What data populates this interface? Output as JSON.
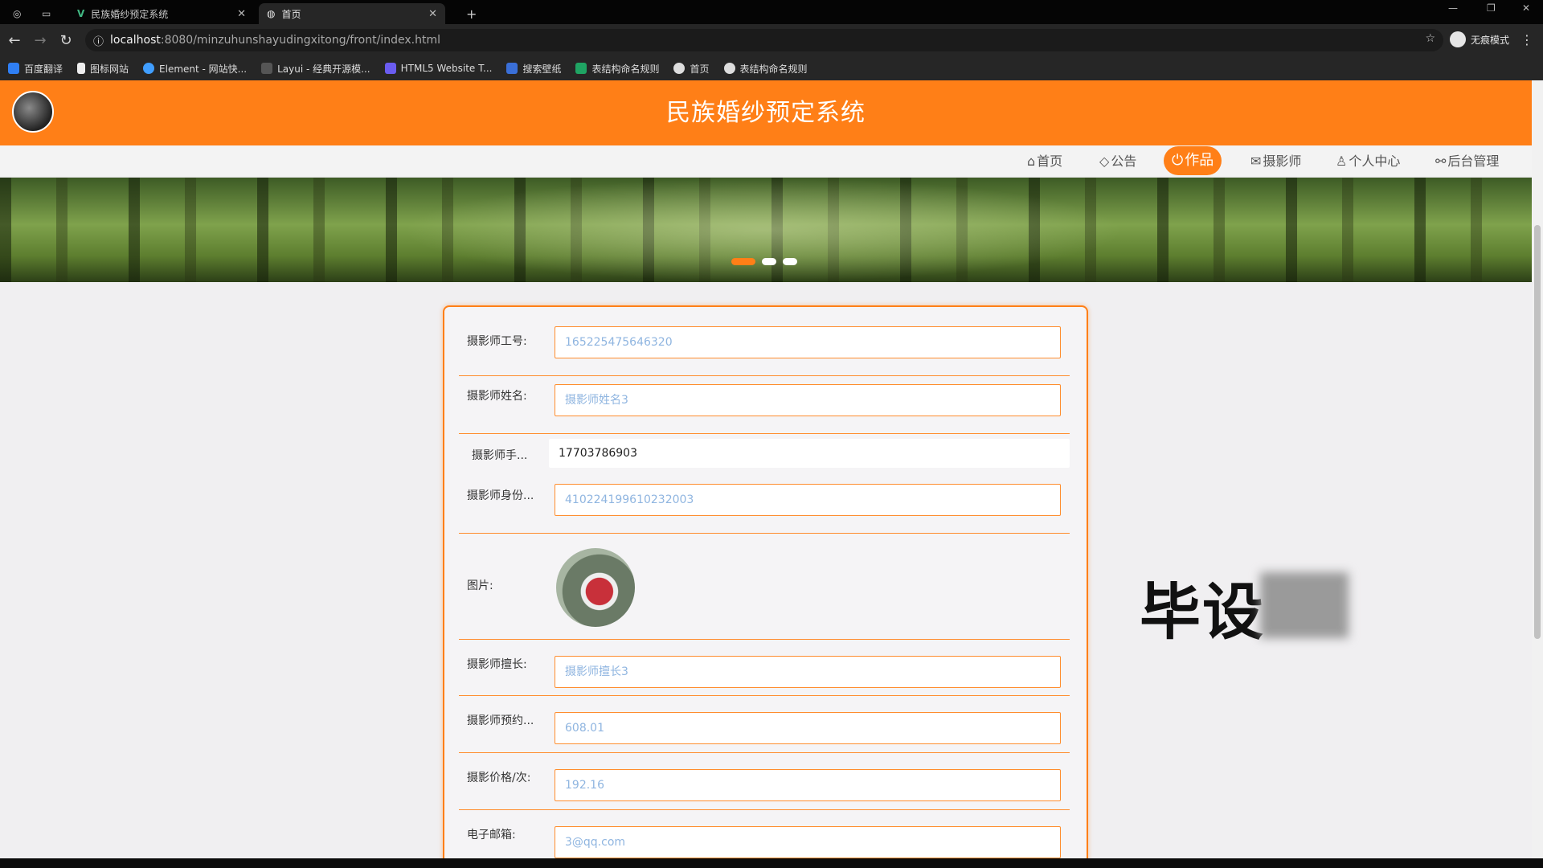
{
  "browser": {
    "tabs": [
      {
        "title": "民族婚纱预定系统",
        "active": false
      },
      {
        "title": "首页",
        "active": true
      }
    ],
    "new_tab": "+",
    "url_host": "localhost",
    "url_rest": ":8080/minzuhunshayudingxitong/front/index.html",
    "incognito_label": "无痕模式",
    "bookmarks": [
      "百度翻译",
      "图标网站",
      "Element - 网站快...",
      "Layui - 经典开源模...",
      "HTML5 Website T...",
      "搜索壁纸",
      "表结构命名规则",
      "首页",
      "表结构命名规则"
    ]
  },
  "site": {
    "title": "民族婚纱预定系统",
    "nav": [
      {
        "label": "首页",
        "icon": "home-icon",
        "active": false
      },
      {
        "label": "公告",
        "icon": "tag-icon",
        "active": false
      },
      {
        "label": "作品",
        "icon": "power-icon",
        "active": true
      },
      {
        "label": "摄影师",
        "icon": "mail-icon",
        "active": false
      },
      {
        "label": "个人中心",
        "icon": "user-icon",
        "active": false
      },
      {
        "label": "后台管理",
        "icon": "link-icon",
        "active": false
      }
    ],
    "carousel_active_index": 0
  },
  "form": {
    "fields": [
      {
        "label": "摄影师工号:",
        "value": "165225475646320"
      },
      {
        "label": "摄影师姓名:",
        "value": "摄影师姓名3"
      },
      {
        "label": "摄影师手...",
        "value": "17703786903"
      },
      {
        "label": "摄影师身份...",
        "value": "410224199610232003"
      },
      {
        "label": "图片:",
        "value": ""
      },
      {
        "label": "摄影师擅长:",
        "value": "摄影师擅长3"
      },
      {
        "label": "摄影师预约...",
        "value": "608.01"
      },
      {
        "label": "摄影价格/次:",
        "value": "192.16"
      },
      {
        "label": "电子邮箱:",
        "value": "3@qq.com"
      }
    ]
  },
  "watermark": {
    "text": "毕设"
  },
  "colors": {
    "brand_orange": "#ff7f17",
    "input_text": "#8fb5e0"
  }
}
